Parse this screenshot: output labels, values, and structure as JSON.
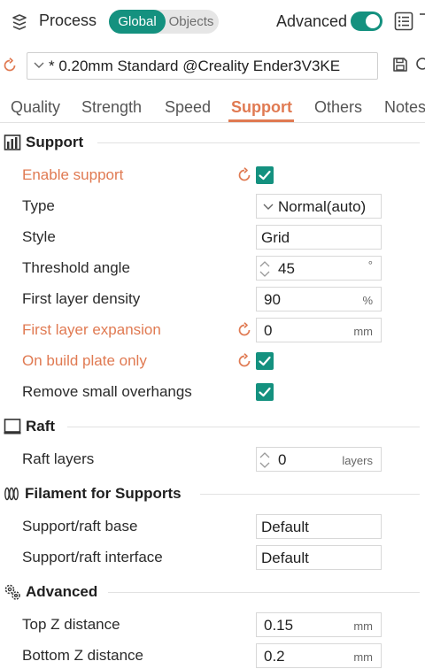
{
  "header": {
    "title": "Process",
    "tabs": [
      "Global",
      "Objects"
    ],
    "advanced_label": "Advanced",
    "advanced_on": true
  },
  "preset": {
    "name": "* 0.20mm Standard @Creality Ender3V3KE"
  },
  "tabs": [
    "Quality",
    "Strength",
    "Speed",
    "Support",
    "Others",
    "Notes"
  ],
  "active_tab": "Support",
  "colors": {
    "accent": "#14917f",
    "modified": "#e07a52"
  },
  "sections": {
    "support": {
      "title": "Support",
      "enable_support": {
        "label": "Enable support",
        "checked": true
      },
      "type": {
        "label": "Type",
        "value": "Normal(auto)"
      },
      "style": {
        "label": "Style",
        "value": "Grid"
      },
      "threshold_angle": {
        "label": "Threshold angle",
        "value": "45",
        "unit": "°"
      },
      "first_layer_density": {
        "label": "First layer density",
        "value": "90",
        "unit": "%"
      },
      "first_layer_expansion": {
        "label": "First layer expansion",
        "value": "0",
        "unit": "mm"
      },
      "on_build_plate_only": {
        "label": "On build plate only",
        "checked": true
      },
      "remove_small_overhangs": {
        "label": "Remove small overhangs",
        "checked": true
      }
    },
    "raft": {
      "title": "Raft",
      "raft_layers": {
        "label": "Raft layers",
        "value": "0",
        "unit": "layers"
      }
    },
    "filament": {
      "title": "Filament for Supports",
      "base": {
        "label": "Support/raft base",
        "value": "Default"
      },
      "interface": {
        "label": "Support/raft interface",
        "value": "Default"
      }
    },
    "advanced": {
      "title": "Advanced",
      "top_z": {
        "label": "Top Z distance",
        "value": "0.15",
        "unit": "mm"
      },
      "bottom_z": {
        "label": "Bottom Z distance",
        "value": "0.2",
        "unit": "mm"
      }
    }
  }
}
